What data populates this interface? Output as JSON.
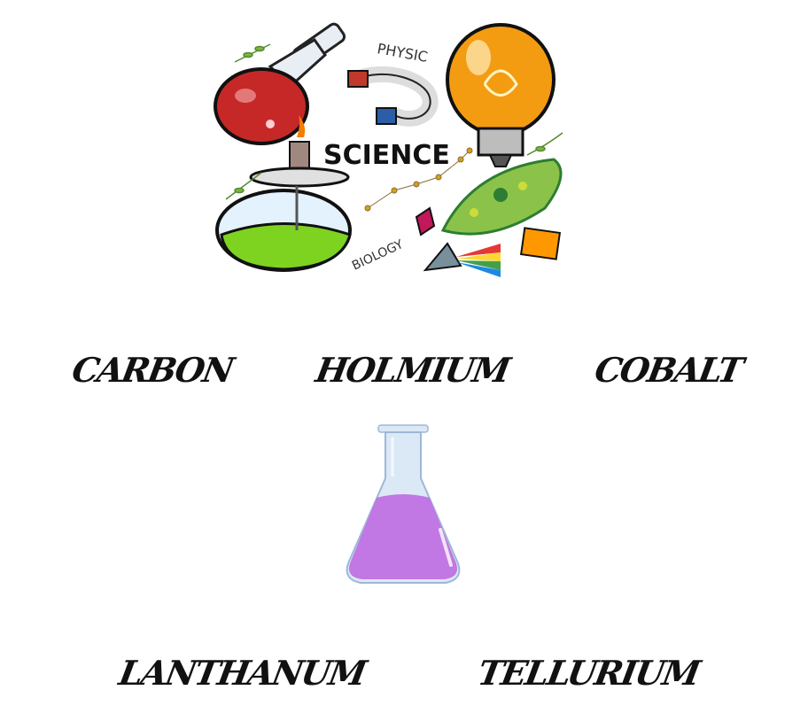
{
  "illustration": {
    "labels": {
      "science": "SCIENCE",
      "physic": "PHYSIC",
      "biology": "BIOLOGY"
    },
    "colors": {
      "flask_red": "#c62828",
      "bulb_orange": "#f39c12",
      "liquid_green": "#7ed321",
      "magnet_red": "#c0392b",
      "magnet_blue": "#2c5ea8",
      "paramecium_green": "#8bc34a"
    }
  },
  "words": {
    "carbon": "CARBON",
    "holmium": "HOLMIUM",
    "cobalt": "COBALT",
    "lanthanum": "LANTHANUM",
    "tellurium": "TELLURIUM"
  },
  "flask": {
    "liquid_color": "#c177e4",
    "glass_color": "#dbe9f7"
  }
}
